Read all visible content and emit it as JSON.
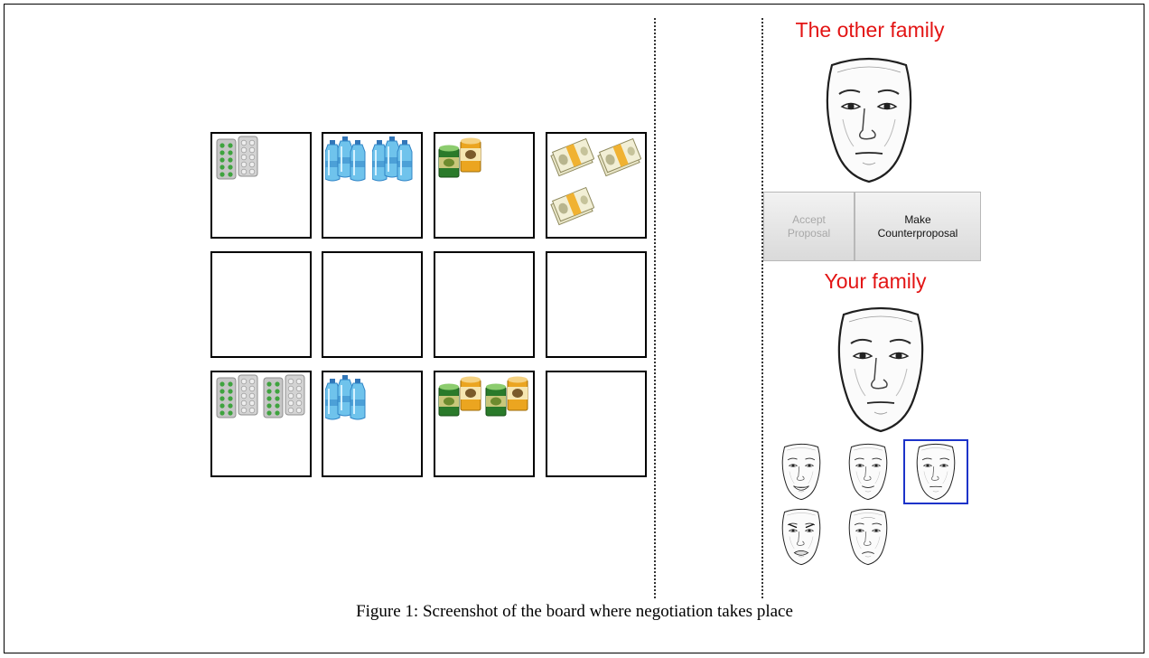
{
  "board": {
    "rows": [
      {
        "name": "top-row",
        "cells": [
          {
            "item": "medicine-icon",
            "count": 2
          },
          {
            "item": "water-bottles-icon",
            "count": 2
          },
          {
            "item": "canned-food-icon",
            "count": 1
          },
          {
            "item": "money-icon",
            "count": 3
          }
        ]
      },
      {
        "name": "middle-row",
        "cells": [
          {
            "item": "",
            "count": 0
          },
          {
            "item": "",
            "count": 0
          },
          {
            "item": "",
            "count": 0
          },
          {
            "item": "",
            "count": 0
          }
        ]
      },
      {
        "name": "bottom-row",
        "cells": [
          {
            "item": "medicine-icon",
            "count": 4
          },
          {
            "item": "water-bottles-icon",
            "count": 1
          },
          {
            "item": "canned-food-icon",
            "count": 2
          },
          {
            "item": "",
            "count": 0
          }
        ]
      }
    ]
  },
  "other_family": {
    "title": "The other family",
    "face": "neutral-face-icon"
  },
  "buttons": {
    "accept": {
      "label": "Accept\nProposal",
      "enabled": false
    },
    "counter": {
      "label": "Make\nCounterproposal",
      "enabled": true
    }
  },
  "your_family": {
    "title": "Your family",
    "face": "neutral-face-icon"
  },
  "emotions": [
    {
      "name": "happy-face-icon",
      "selected": false
    },
    {
      "name": "smiling-face-icon",
      "selected": false
    },
    {
      "name": "neutral-face-icon",
      "selected": true
    },
    {
      "name": "angry-face-icon",
      "selected": false
    },
    {
      "name": "sad-face-icon",
      "selected": false
    }
  ],
  "colors": {
    "title": "#e31414",
    "selection": "#1c33c9"
  },
  "caption": "Figure 1: Screenshot of the board where negotiation takes place"
}
